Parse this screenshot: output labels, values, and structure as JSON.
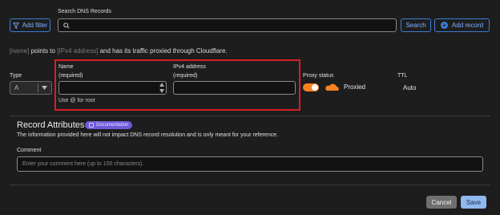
{
  "toolbar": {
    "add_filter_label": "Add filter",
    "search_heading": "Search DNS Records",
    "search_placeholder": "",
    "search_button_label": "Search",
    "add_record_label": "Add record"
  },
  "record_summary": {
    "name_token": "[name]",
    "text_1": "points to",
    "ipv4_token": "[IPv4 address]",
    "text_2": "and has its traffic proxied through Cloudflare."
  },
  "form": {
    "type_label": "Type",
    "type_value": "A",
    "name_label": "Name",
    "name_required": "(required)",
    "name_help": "Use @ for root",
    "ipv4_label": "IPv4 address",
    "ipv4_required": "(required)",
    "proxy_label": "Proxy status",
    "proxy_value": "Proxied",
    "ttl_label": "TTL",
    "ttl_value": "Auto"
  },
  "attributes": {
    "heading": "Record Attributes",
    "doc_badge": "Documentation",
    "description": "The information provided here will not impact DNS record resolution and is only meant for your reference.",
    "comment_label": "Comment",
    "comment_placeholder": "Enter your comment here (up to 100 characters)."
  },
  "footer": {
    "cancel_label": "Cancel",
    "save_label": "Save"
  },
  "colors": {
    "accent_blue": "#3b7fd9",
    "cloudflare_orange": "#f6821f",
    "highlight_red": "#d91e24",
    "badge_purple": "#6e5ad9"
  }
}
